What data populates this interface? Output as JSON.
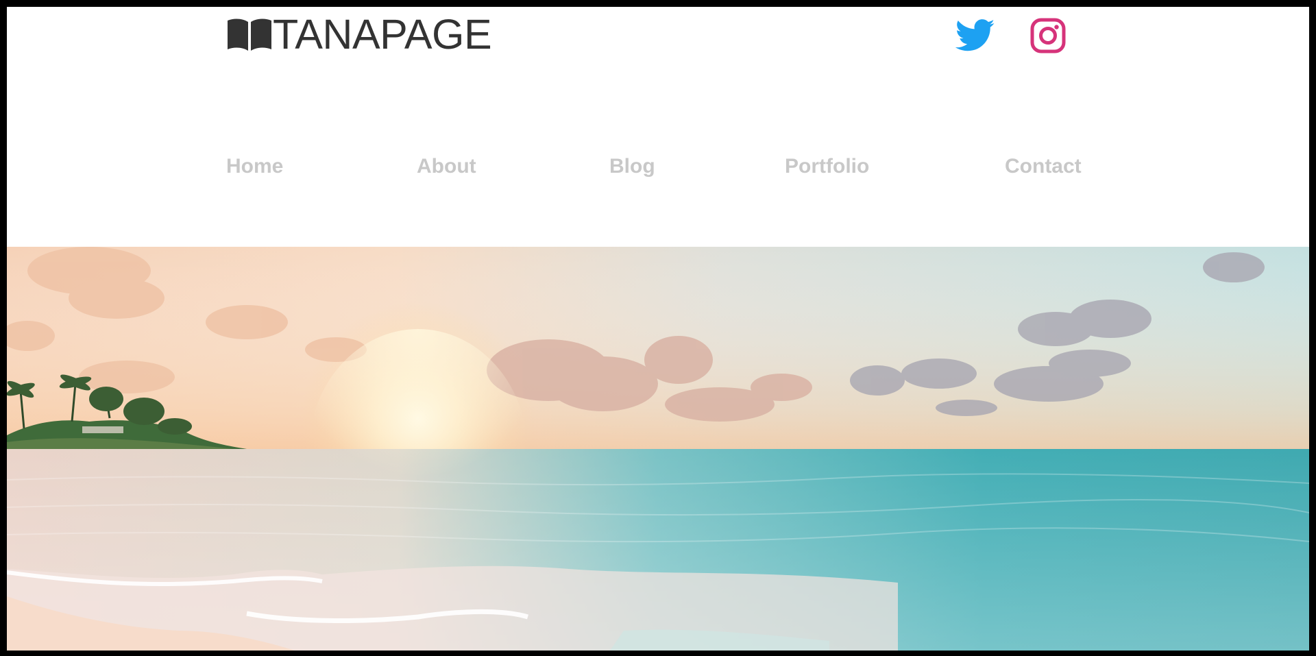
{
  "brand": {
    "name": "TANAPAGE",
    "text_color": "#333333"
  },
  "social": {
    "twitter": {
      "icon": "twitter-icon",
      "color": "#1DA1F2"
    },
    "instagram": {
      "icon": "instagram-icon",
      "color": "#D6337A"
    }
  },
  "nav": {
    "items": [
      {
        "label": "Home"
      },
      {
        "label": "About"
      },
      {
        "label": "Blog"
      },
      {
        "label": "Portfolio"
      },
      {
        "label": "Contact"
      }
    ],
    "text_color": "#c8c8c8"
  },
  "hero": {
    "image": "beach-sunset-photo"
  }
}
